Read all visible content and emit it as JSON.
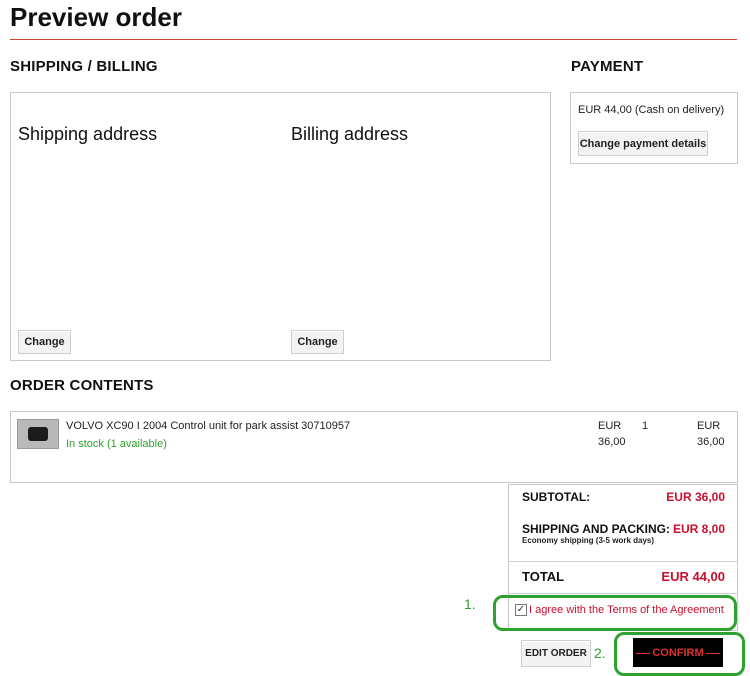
{
  "page": {
    "title": "Preview order"
  },
  "shipping_billing": {
    "heading": "SHIPPING / BILLING",
    "shipping": {
      "heading": "Shipping address",
      "change_label": "Change"
    },
    "billing": {
      "heading": "Billing address",
      "change_label": "Change"
    }
  },
  "payment": {
    "heading": "PAYMENT",
    "info": "EUR 44,00 (Cash on delivery)",
    "change_label": "Change payment details"
  },
  "order_contents": {
    "heading": "ORDER CONTENTS",
    "items": [
      {
        "name": "VOLVO XC90 I 2004 Control unit for park assist 30710957",
        "stock": "In stock (1 available)",
        "unit_price_currency": "EUR",
        "unit_price_amount": "36,00",
        "quantity": "1",
        "total_currency": "EUR",
        "total_amount": "36,00"
      }
    ]
  },
  "summary": {
    "subtotal_label": "SUBTOTAL:",
    "subtotal_value": "EUR 36,00",
    "shipping_label": "SHIPPING AND PACKING:",
    "shipping_value": "EUR 8,00",
    "shipping_note": "Economy shipping (3-5 work days)",
    "total_label": "TOTAL",
    "total_value": "EUR 44,00",
    "agree_label": "I agree with the Terms of the Agreement",
    "agree_checked": "✓",
    "edit_order_label": "EDIT ORDER",
    "confirm_label": "CONFIRM"
  },
  "annotations": {
    "step1": "1.",
    "step2": "2."
  },
  "colors": {
    "accent_red": "#c8102e",
    "annotation_green": "#2ea12e",
    "rule": "#c9472f"
  }
}
